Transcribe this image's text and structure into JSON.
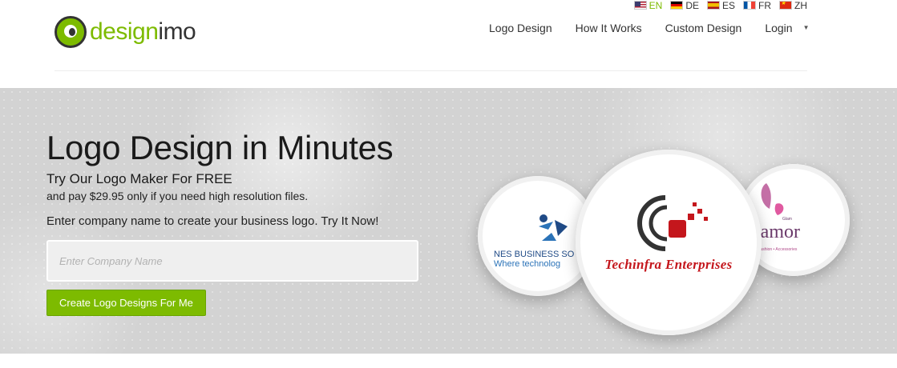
{
  "languages": [
    {
      "code": "EN",
      "active": true
    },
    {
      "code": "DE",
      "active": false
    },
    {
      "code": "ES",
      "active": false
    },
    {
      "code": "FR",
      "active": false
    },
    {
      "code": "ZH",
      "active": false
    }
  ],
  "brand": {
    "part1": "design",
    "part2": "imo"
  },
  "nav": {
    "logo_design": "Logo Design",
    "how_it_works": "How It Works",
    "custom_design": "Custom Design",
    "login": "Login"
  },
  "hero": {
    "title": "Logo Design in Minutes",
    "subtitle": "Try Our Logo Maker For FREE",
    "price_note": "and pay $29.95 only if you need high resolution files.",
    "cta_text": "Enter company name to create your business logo. Try It Now!",
    "input_placeholder": "Enter Company Name",
    "button_label": "Create Logo Designs For Me"
  },
  "showcase": {
    "left": {
      "line1": "NES BUSINESS SO",
      "line2": "Where technolog"
    },
    "center": {
      "name": "Techinfra Enterprises"
    },
    "right": {
      "name": "mamor",
      "tag": "Glam",
      "sub": "Care • Fashion • Accessories"
    }
  },
  "colors": {
    "accent": "#7dbb00",
    "dark": "#333333",
    "tech_red": "#c4161c"
  }
}
